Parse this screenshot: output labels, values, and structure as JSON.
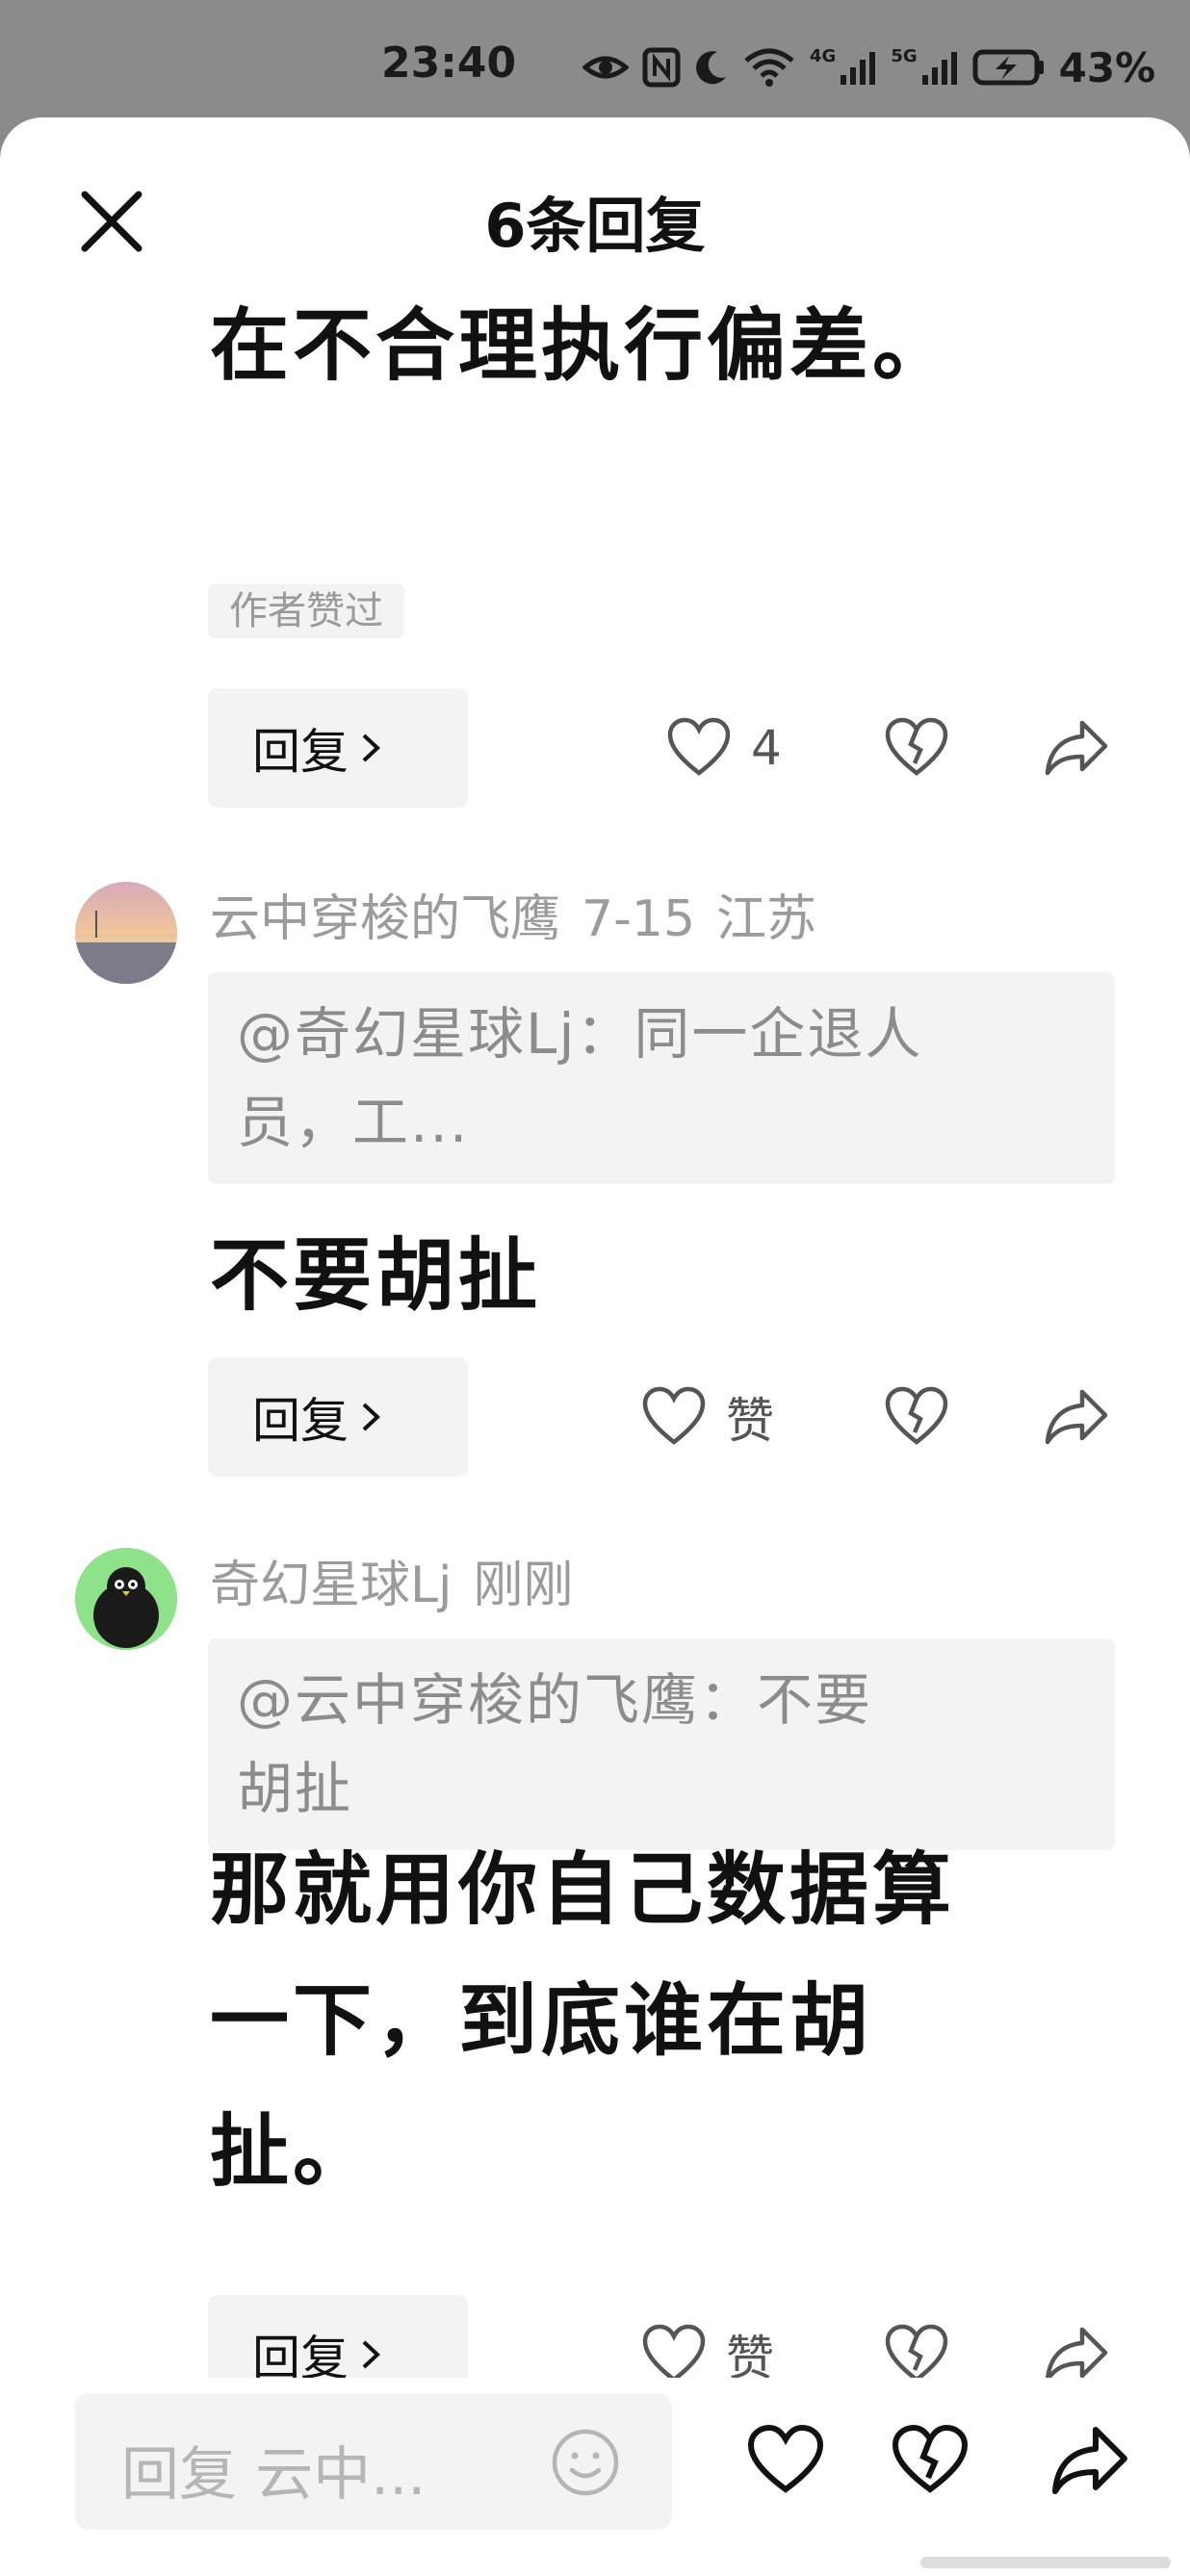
{
  "status_bar": {
    "time": "23:40",
    "sig1": "4G",
    "sig2": "5G",
    "battery": "43%"
  },
  "header": {
    "title": "6条回复"
  },
  "comments": [
    {
      "text_lines": [
        "在不合理执行偏差。"
      ],
      "author_liked": "作者赞过",
      "reply_label": "回复",
      "like_count": "4"
    },
    {
      "username": "云中穿梭的飞鹰",
      "date": "7-15",
      "location": "江苏",
      "quote_lines": [
        "@奇幻星球Lj：同一企退人",
        "员，工..."
      ],
      "text_lines": [
        "不要胡扯"
      ],
      "reply_label": "回复",
      "like_label": "赞"
    },
    {
      "username": "奇幻星球Lj",
      "date": "刚刚",
      "quote_lines": [
        "@云中穿梭的飞鹰：不要",
        "胡扯"
      ],
      "text_lines": [
        "那就用你自己数据算",
        "一下，到底谁在胡",
        "扯。"
      ],
      "reply_label": "回复",
      "like_label": "赞"
    }
  ],
  "input": {
    "placeholder": "回复 云中..."
  }
}
